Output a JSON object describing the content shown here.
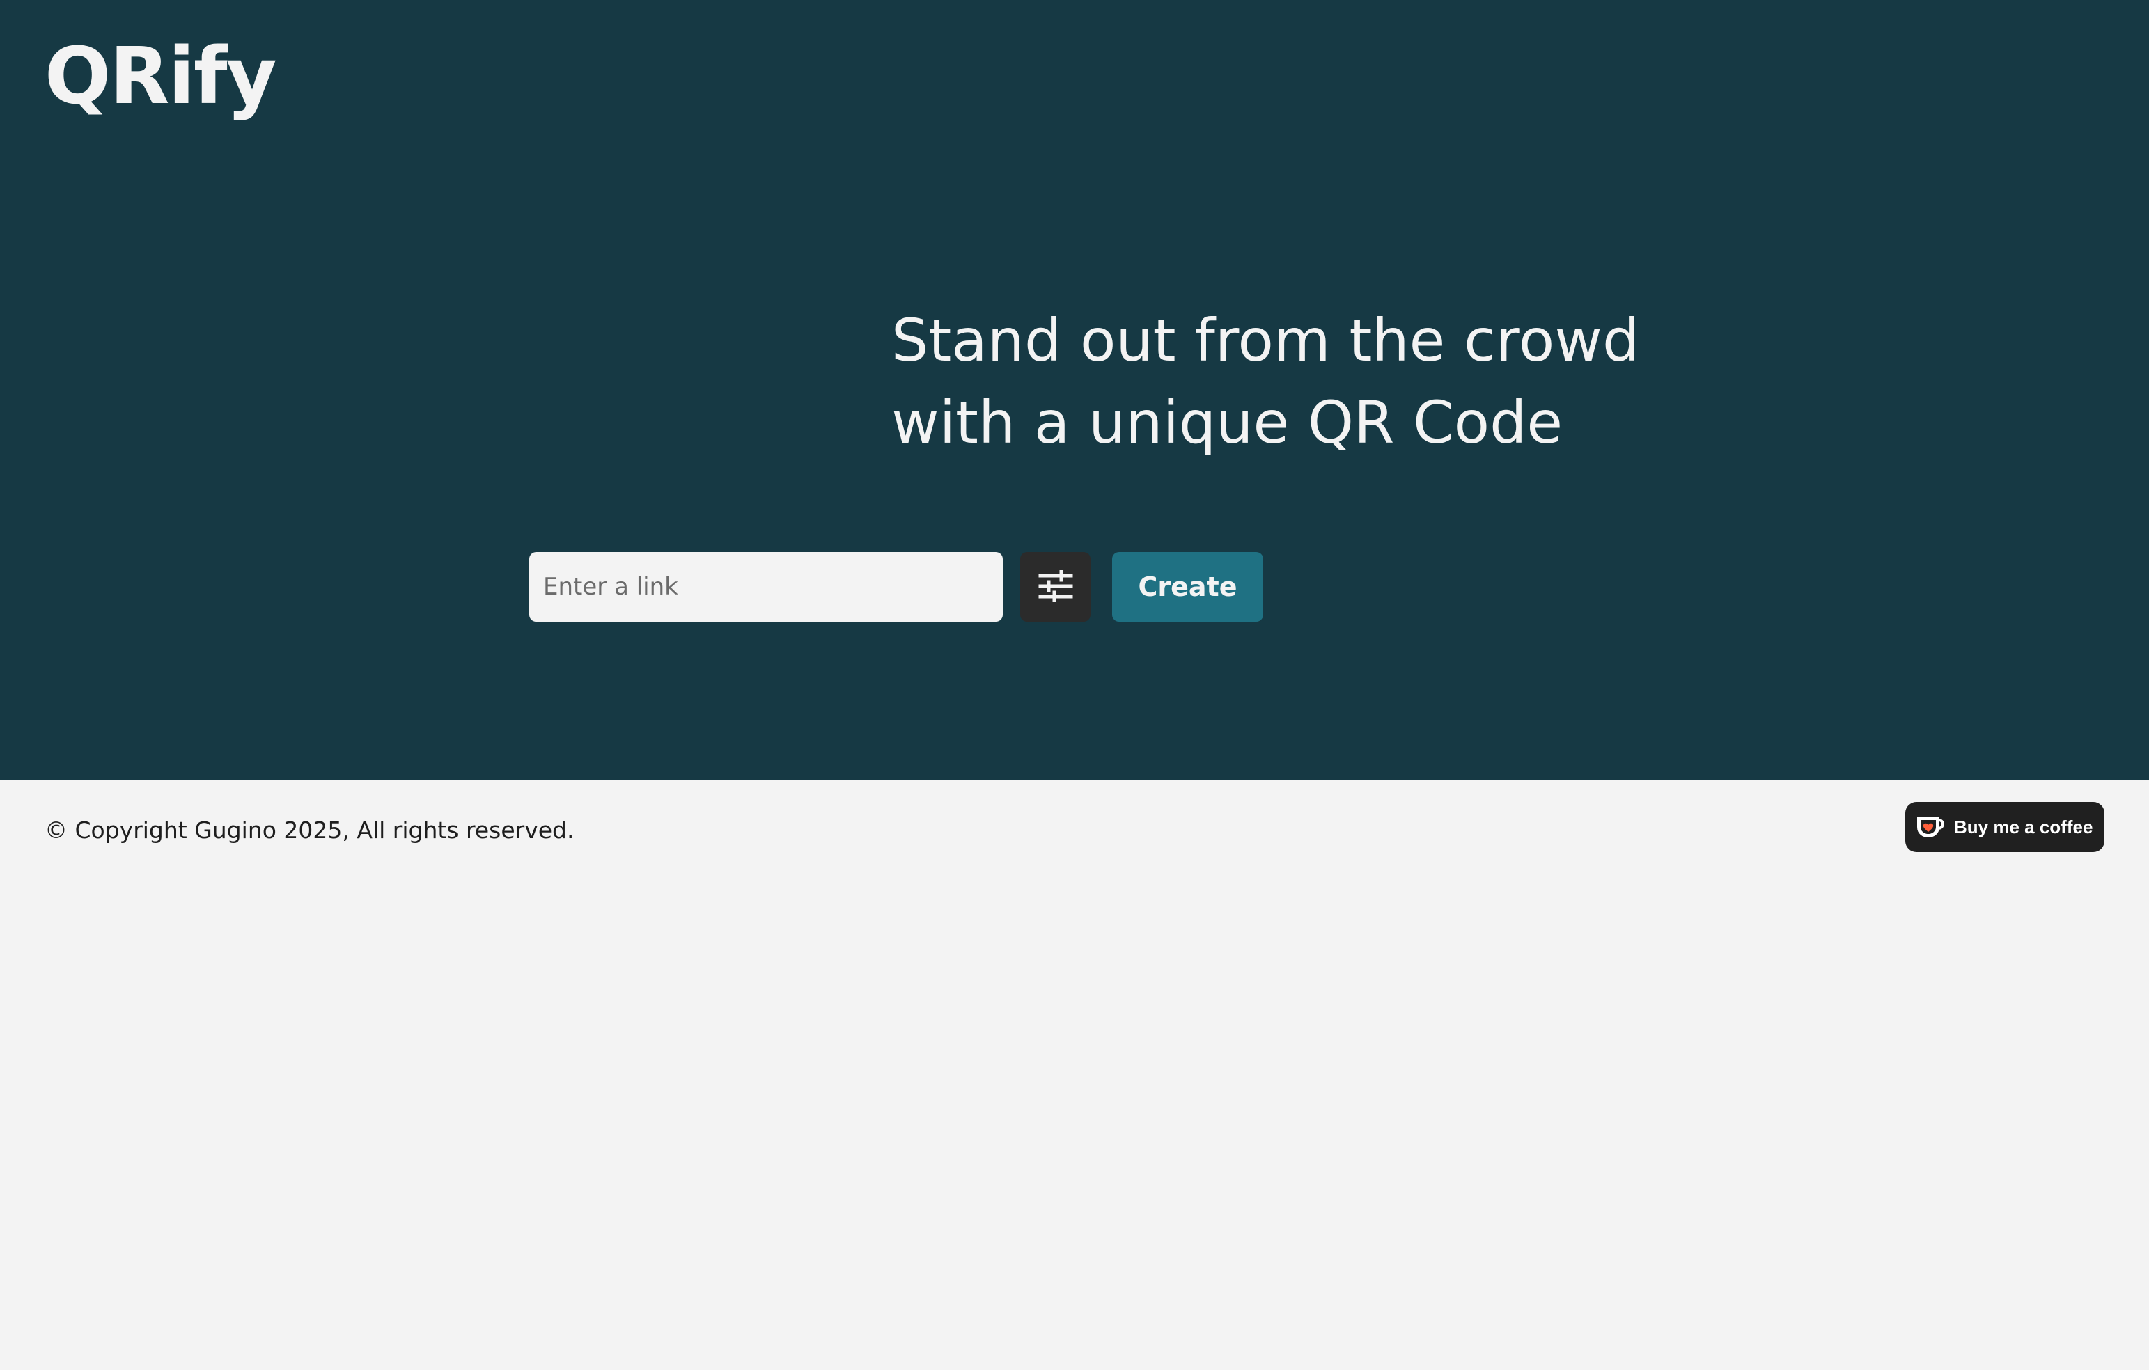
{
  "header": {
    "logo": "QRify"
  },
  "hero": {
    "headline_line1": "Stand out from the crowd",
    "headline_line2": "with a unique QR Code",
    "link_input": {
      "placeholder": "Enter a link",
      "value": ""
    },
    "settings_icon": "sliders-icon",
    "create_label": "Create"
  },
  "footer": {
    "copyright": "© Copyright Gugino 2025, All rights reserved.",
    "coffee_label": "Buy me a coffee",
    "coffee_icon": "coffee-cup-icon"
  },
  "colors": {
    "hero_bg": "#163944",
    "page_bg": "#f3f3f3",
    "accent": "#1f7183",
    "settings_bg": "#2b2b2b",
    "coffee_bg": "#202020"
  }
}
